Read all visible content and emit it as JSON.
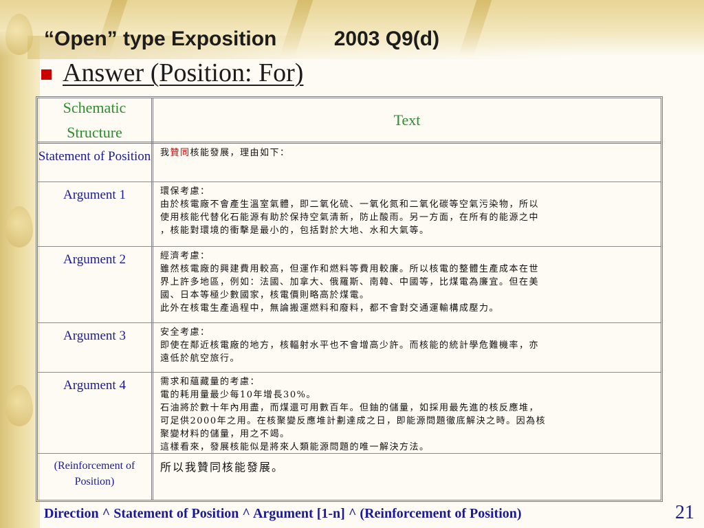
{
  "slide": {
    "title": "“Open” type Exposition          2003 Q9(d)",
    "subtitle": "Answer (Position: For)",
    "footer": "Direction ^ Statement of Position ^ Argument [1-n] ^ (Reinforcement of Position)",
    "page_number": "21"
  },
  "table": {
    "header_left": "Schematic Structure",
    "header_right": "Text",
    "rows": [
      {
        "label": "Statement of Position",
        "lines": [],
        "intro": "我",
        "highlight": "贊同",
        "rest": "核能發展，理由如下："
      },
      {
        "label": "Argument 1",
        "lines": [
          "環保考慮：",
          "由於核電廠不會產生溫室氣體，即二氧化硫、一氧化氮和二氧化碳等空氣污染物，所以",
          "使用核能代替化石能源有助於保持空氣清新，防止酸雨。另一方面，在所有的能源之中",
          "，核能對環境的衝擊是最小的，包括對於大地、水和大氣等。"
        ]
      },
      {
        "label": "Argument 2",
        "lines": [
          "經濟考慮：",
          "雖然核電廠的興建費用較高，但運作和燃料等費用較廉。所以核電的整體生產成本在世",
          "界上許多地區，例如：法國、加拿大、俄羅斯、南韓、中國等，比煤電為廉宜。但在美",
          "國、日本等極少數國家，核電價則略高於煤電。",
          "此外在核電生產過程中，無論搬運燃料和廢料，都不會對交通運輸構成壓力。"
        ]
      },
      {
        "label": "Argument 3",
        "lines": [
          "安全考慮：",
          "即使在鄰近核電廠的地方，核輻射水平也不會增高少許。而核能的統計學危難機率，亦",
          "遠低於航空旅行。"
        ]
      },
      {
        "label": "Argument 4",
        "lines": [
          "需求和蘊藏量的考慮：",
          "電的耗用量最少每10年增長30%。",
          "石油將於數十年內用盡，而煤還可用數百年。但鈾的儲量，如採用最先進的核反應堆，",
          "可足供2000年之用。在核聚變反應堆計劃達成之日，即能源問題徹底解決之時。因為核",
          "聚變材料的儲量，用之不竭。",
          "這樣看來，發展核能似是將來人類能源問題的唯一解決方法。"
        ]
      },
      {
        "label": "(Reinforcement of Position)",
        "lines": [
          "所以我贊同核能發展。"
        ]
      }
    ]
  },
  "colors": {
    "header_text": "#2e8b2e",
    "label_text": "#1a1a99",
    "highlight": "#cc0000",
    "bullet": "#cc0000"
  }
}
